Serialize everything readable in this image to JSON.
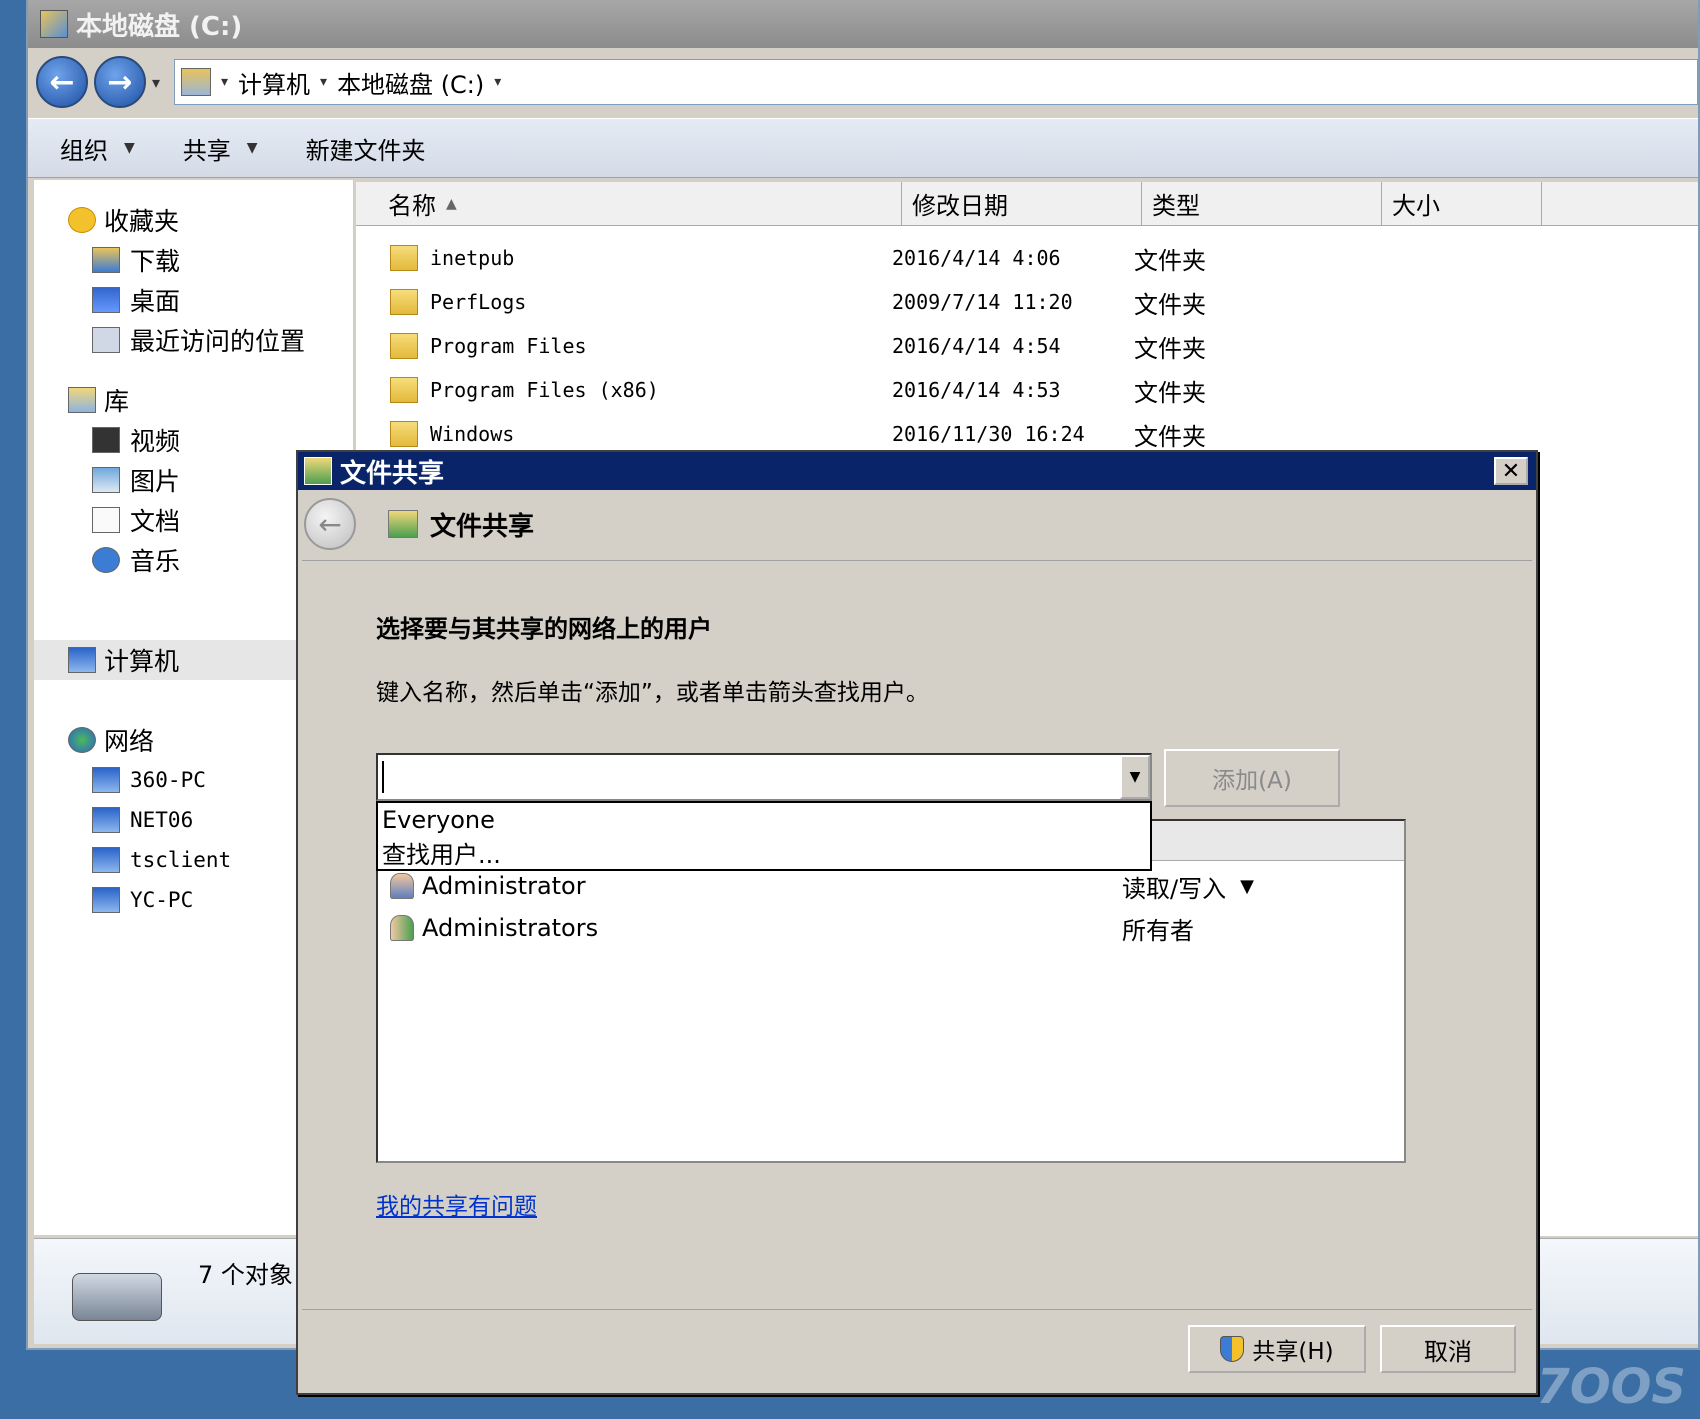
{
  "explorer": {
    "title": "本地磁盘 (C:)",
    "address": {
      "segments": [
        "计算机",
        "本地磁盘 (C:)"
      ]
    },
    "toolbar": {
      "organize": "组织",
      "share": "共享",
      "new_folder": "新建文件夹"
    },
    "nav": {
      "favorites": {
        "label": "收藏夹",
        "items": [
          "下载",
          "桌面",
          "最近访问的位置"
        ]
      },
      "libraries": {
        "label": "库",
        "items": [
          "视频",
          "图片",
          "文档",
          "音乐"
        ]
      },
      "computer": "计算机",
      "network": {
        "label": "网络",
        "items": [
          "360-PC",
          "NET06",
          "tsclient",
          "YC-PC"
        ]
      }
    },
    "columns": {
      "name": "名称",
      "modified": "修改日期",
      "type": "类型",
      "size": "大小"
    },
    "files": [
      {
        "name": "inetpub",
        "date": "2016/4/14 4:06",
        "type": "文件夹"
      },
      {
        "name": "PerfLogs",
        "date": "2009/7/14 11:20",
        "type": "文件夹"
      },
      {
        "name": "Program Files",
        "date": "2016/4/14 4:54",
        "type": "文件夹"
      },
      {
        "name": "Program Files (x86)",
        "date": "2016/4/14 4:53",
        "type": "文件夹"
      },
      {
        "name": "Windows",
        "date": "2016/11/30 16:24",
        "type": "文件夹"
      }
    ],
    "status": "7 个对象"
  },
  "dialog": {
    "title": "文件共享",
    "heading": "文件共享",
    "instruction": "选择要与其共享的网络上的用户",
    "hint": "键入名称，然后单击“添加”，或者单击箭头查找用户。",
    "input": {
      "value": ""
    },
    "add_label": "添加(A)",
    "dropdown": [
      "Everyone",
      "查找用户..."
    ],
    "users": [
      {
        "name": "Administrator",
        "permission": "读取/写入"
      },
      {
        "name": "Administrators",
        "permission": "所有者"
      }
    ],
    "help_link": "我的共享有问题",
    "share_label": "共享(H)",
    "cancel_label": "取消"
  },
  "icons": {
    "back": "back-arrow-icon",
    "forward": "forward-arrow-icon",
    "close": "close-icon",
    "folder": "folder-icon",
    "user": "user-icon",
    "group": "user-group-icon",
    "shield": "uac-shield-icon"
  }
}
